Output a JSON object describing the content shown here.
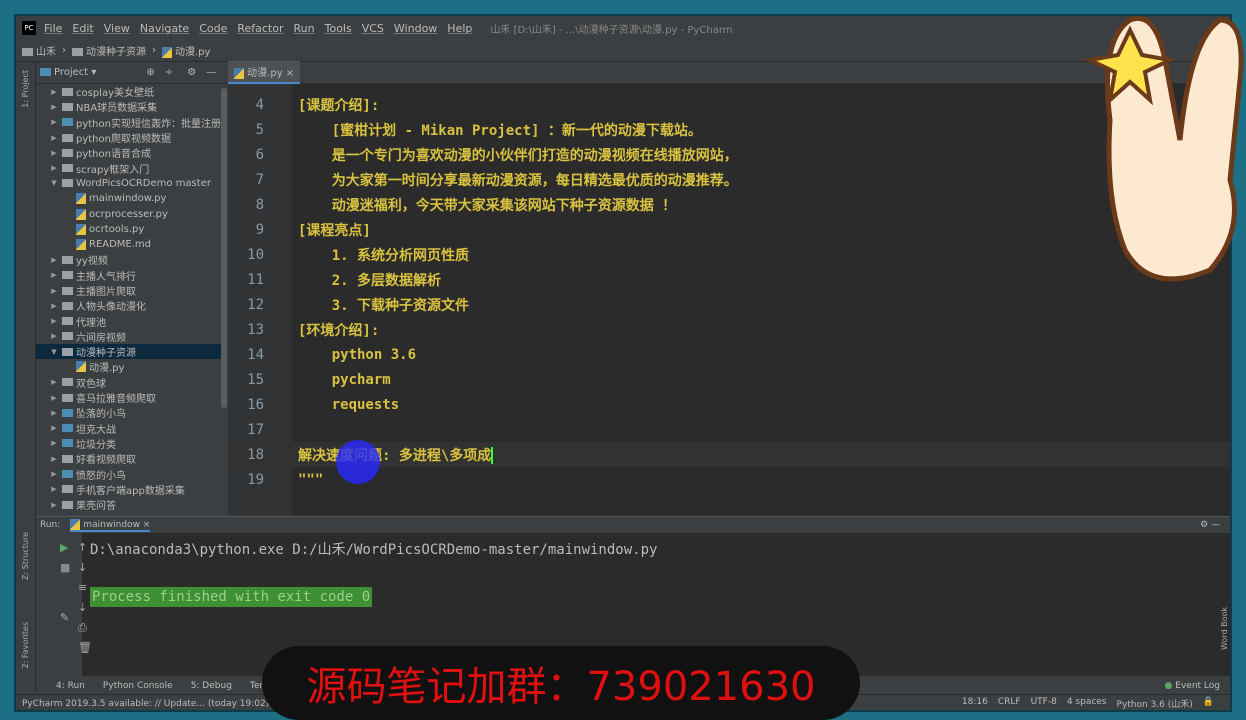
{
  "window": {
    "title": "山禾 [D:\\山禾] - ...\\动漫种子资源\\动漫.py - PyCharm"
  },
  "menu": [
    "File",
    "Edit",
    "View",
    "Navigate",
    "Code",
    "Refactor",
    "Run",
    "Tools",
    "VCS",
    "Window",
    "Help"
  ],
  "breadcrumb": [
    "山禾",
    "动漫种子资源",
    "动漫.py"
  ],
  "project": {
    "label": "Project",
    "tab": "动漫.py",
    "side_tab": "1: Project"
  },
  "tree": [
    {
      "label": "cosplay美女壁纸",
      "type": "folder"
    },
    {
      "label": "NBA球员数据采集",
      "type": "folder"
    },
    {
      "label": "python实现短信轰炸：批量注册",
      "type": "folder-blue"
    },
    {
      "label": "python爬取视频数据",
      "type": "folder"
    },
    {
      "label": "python语音合成",
      "type": "folder"
    },
    {
      "label": "scrapy框架入门",
      "type": "folder"
    },
    {
      "label": "WordPicsOCRDemo master",
      "type": "folder-open"
    },
    {
      "label": "mainwindow.py",
      "type": "py"
    },
    {
      "label": "ocrprocesser.py",
      "type": "py"
    },
    {
      "label": "ocrtools.py",
      "type": "py"
    },
    {
      "label": "README.md",
      "type": "md"
    },
    {
      "label": "yy视频",
      "type": "folder"
    },
    {
      "label": "主播人气排行",
      "type": "folder"
    },
    {
      "label": "主播图片爬取",
      "type": "folder"
    },
    {
      "label": "人物头像动漫化",
      "type": "folder"
    },
    {
      "label": "代理池",
      "type": "folder"
    },
    {
      "label": "六间房视频",
      "type": "folder"
    },
    {
      "label": "动漫种子资源",
      "type": "folder-open-selected"
    },
    {
      "label": "动漫.py",
      "type": "py"
    },
    {
      "label": "双色球",
      "type": "folder"
    },
    {
      "label": "喜马拉雅音频爬取",
      "type": "folder"
    },
    {
      "label": "坠落的小鸟",
      "type": "folder-blue"
    },
    {
      "label": "坦克大战",
      "type": "folder-blue"
    },
    {
      "label": "垃圾分类",
      "type": "folder-blue"
    },
    {
      "label": "好看视频爬取",
      "type": "folder"
    },
    {
      "label": "愤怒的小鸟",
      "type": "folder-blue"
    },
    {
      "label": "手机客户端app数据采集",
      "type": "folder"
    },
    {
      "label": "果壳问答",
      "type": "folder"
    }
  ],
  "code": [
    {
      "n": "4",
      "t": "[课题介绍]:"
    },
    {
      "n": "5",
      "t": "    [蜜柑计划 - Mikan Project] ：新一代的动漫下载站。"
    },
    {
      "n": "6",
      "t": "    是一个专门为喜欢动漫的小伙伴们打造的动漫视频在线播放网站，"
    },
    {
      "n": "7",
      "t": "    为大家第一时间分享最新动漫资源，每日精选最优质的动漫推荐。"
    },
    {
      "n": "8",
      "t": "    动漫迷福利，今天带大家采集该网站下种子资源数据 ！"
    },
    {
      "n": "9",
      "t": "[课程亮点]"
    },
    {
      "n": "10",
      "t": "    1. 系统分析网页性质"
    },
    {
      "n": "11",
      "t": "    2. 多层数据解析"
    },
    {
      "n": "12",
      "t": "    3. 下载种子资源文件"
    },
    {
      "n": "13",
      "t": "[环境介绍]:"
    },
    {
      "n": "14",
      "t": "    python 3.6"
    },
    {
      "n": "15",
      "t": "    pycharm"
    },
    {
      "n": "16",
      "t": "    requests"
    },
    {
      "n": "17",
      "t": ""
    },
    {
      "n": "18",
      "t": "解决速度问题: 多进程\\多项成"
    },
    {
      "n": "19",
      "t": "\"\"\""
    }
  ],
  "run": {
    "label": "Run:",
    "tab": "mainwindow",
    "command": "D:\\anaconda3\\python.exe D:/山禾/WordPicsOCRDemo-master/mainwindow.py",
    "result": "Process finished with exit code 0"
  },
  "side_tabs": {
    "structure": "Z: Structure",
    "favorites": "2: Favorites",
    "wordbook": "Word Book"
  },
  "bottom_tools": [
    "4: Run",
    "Python Console",
    "5: Debug",
    "Terminal"
  ],
  "event_log": "Event Log",
  "status": {
    "message": "PyCharm 2019.3.5 available: // Update... (today 19:02)",
    "position": "18:16",
    "line_sep": "CRLF",
    "encoding": "UTF-8",
    "indent": "4 spaces",
    "interpreter": "Python 3.6 (山禾)"
  },
  "promo": "源码笔记加群：739021630"
}
